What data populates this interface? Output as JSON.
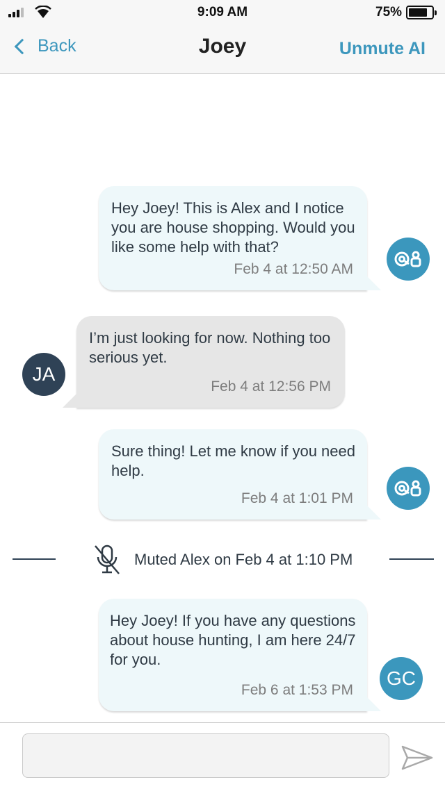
{
  "status_bar": {
    "time": "9:09 AM",
    "battery_percent": "75%",
    "battery_level": 0.75,
    "signal_icon": "cellular-signal-icon",
    "wifi_icon": "wifi-icon"
  },
  "nav": {
    "back_label": "Back",
    "title": "Joey",
    "unmute_label": "Unmute AI"
  },
  "messages": [
    {
      "direction": "outgoing",
      "text": "Hey Joey! This is Alex and I notice you are house shopping. Would you like some help with that?",
      "time": "Feb 4 at 12:50 AM",
      "avatar": "ai-bot-icon"
    },
    {
      "direction": "incoming",
      "text": "I’m just looking for now. Nothing too serious yet.",
      "time": "Feb 4 at 12:56 PM",
      "avatar": "JA"
    },
    {
      "direction": "outgoing",
      "text": "Sure thing! Let me know if you need help.",
      "time": "Feb 4 at 1:01 PM",
      "avatar": "ai-bot-icon"
    },
    {
      "direction": "outgoing",
      "text": "Hey Joey! If you have any questions about house hunting, I am here 24/7 for you.",
      "time": "Feb 6 at 1:53 PM",
      "avatar": "GC"
    }
  ],
  "muted_notice": {
    "text": "Muted Alex on Feb 4 at 1:10 PM",
    "icon": "muted-microphone-icon"
  },
  "composer": {
    "input_value": "",
    "placeholder": "",
    "send_icon": "send-arrow-icon"
  },
  "colors": {
    "accent": "#3d97bd",
    "dark_avatar": "#2f4256",
    "outgoing_bubble": "#eef8fa",
    "incoming_bubble": "#e6e6e6"
  }
}
